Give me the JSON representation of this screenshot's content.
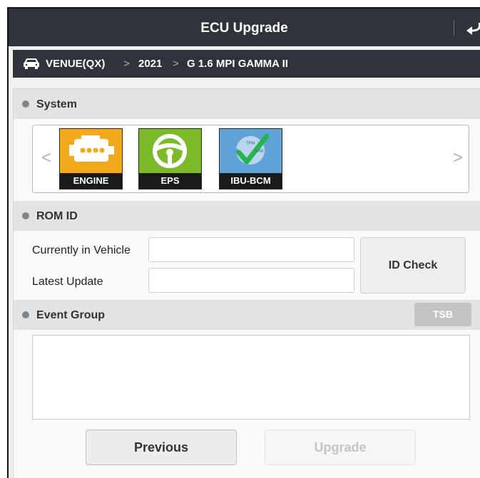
{
  "header": {
    "title": "ECU Upgrade"
  },
  "breadcrumb": {
    "icon": "car-icon",
    "items": [
      "VENUE(QX)",
      "2021",
      "G 1.6 MPI GAMMA II"
    ],
    "separator": ">"
  },
  "system": {
    "label": "System",
    "prev_arrow": "<",
    "next_arrow": ">",
    "tiles": [
      {
        "label": "ENGINE",
        "icon": "engine-icon",
        "color": "#f2a91d"
      },
      {
        "label": "EPS",
        "icon": "steering-wheel-icon",
        "color": "#7cba2a"
      },
      {
        "label": "IBU-BCM",
        "icon": "ibu-bcm-checkmark-icon",
        "color": "#5ea4d8",
        "badges": [
          "TPM",
          "SMK",
          "B"
        ]
      }
    ]
  },
  "rom_id": {
    "label": "ROM ID",
    "currently_label": "Currently in Vehicle",
    "currently_value": "",
    "latest_label": "Latest Update",
    "latest_value": "",
    "id_check_label": "ID Check"
  },
  "event_group": {
    "label": "Event Group",
    "tsb_label": "TSB"
  },
  "footer": {
    "previous_label": "Previous",
    "upgrade_label": "Upgrade"
  },
  "colors": {
    "header_bg": "#2f343a",
    "section_bg": "#e1e3e5",
    "engine_tile": "#f2a91d",
    "eps_tile": "#7cba2a",
    "ibu_tile": "#5ea4d8",
    "check_green": "#26b54a"
  }
}
